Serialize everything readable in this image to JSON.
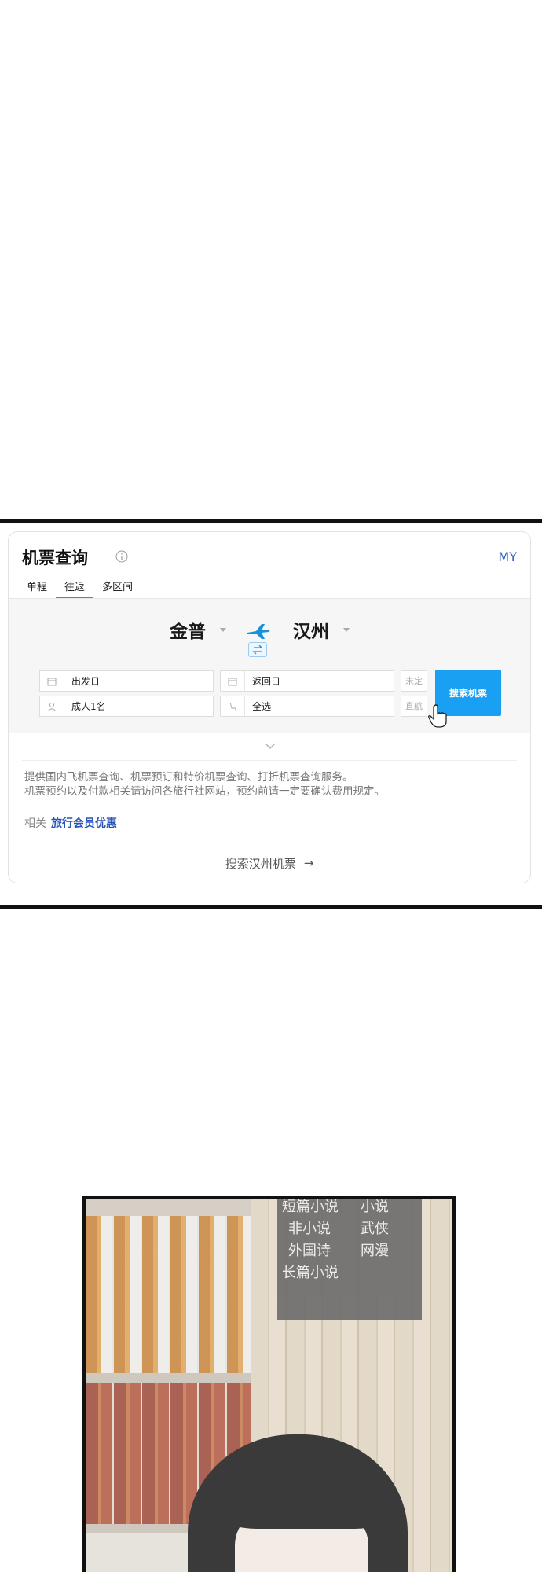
{
  "widget": {
    "title": "机票查询",
    "top_right_link": "MY",
    "tabs": [
      {
        "label": "单程",
        "active": false
      },
      {
        "label": "往返",
        "active": true
      },
      {
        "label": "多区间",
        "active": false
      }
    ],
    "from_city": "金普",
    "to_city": "汉州",
    "fields": {
      "depart_date": "出发日",
      "return_date": "返回日",
      "passengers": "成人1名",
      "seat_class": "全选",
      "undecided": "未定",
      "direct": "直航"
    },
    "search_button": "搜索机票",
    "description_line1": "提供国内飞机票查询、机票预订和特价机票查询、打折机票查询服务。",
    "description_line2": "机票预约以及付款相关请访问各旅行社网站，预约前请一定要确认费用规定。",
    "related_label": "相关",
    "related_link": "旅行会员优惠",
    "footer_link": "搜索汉州机票",
    "footer_arrow": "→",
    "colors": {
      "accent": "#1aa0f2",
      "link": "#2553b8",
      "tab_underline": "#2f8ef5"
    }
  },
  "comic": {
    "sign_lines": [
      [
        "短篇小说",
        "小说"
      ],
      [
        "非小说",
        "武侠"
      ],
      [
        "外国诗",
        "网漫"
      ],
      [
        "长篇小说",
        ""
      ]
    ]
  }
}
